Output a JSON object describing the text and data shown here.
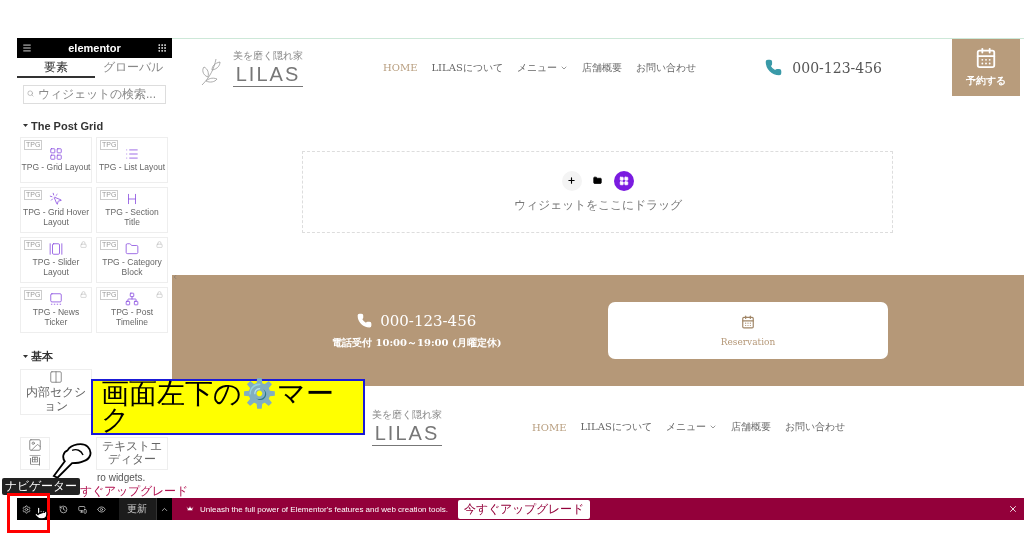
{
  "sidebar": {
    "brand": "elementor",
    "tabs": [
      {
        "label": "要素",
        "selected": true
      },
      {
        "label": "グローバル",
        "selected": false
      }
    ],
    "search": {
      "placeholder": "ウィジェットの検索..."
    },
    "sections": [
      {
        "title": "The Post Grid",
        "expanded": true,
        "widgets": [
          {
            "badge": "TPG",
            "label": "TPG - Grid Layout",
            "locked": false
          },
          {
            "badge": "TPG",
            "label": "TPG - List Layout",
            "locked": false
          },
          {
            "badge": "TPG",
            "label": "TPG - Grid Hover Layout",
            "locked": false
          },
          {
            "badge": "TPG",
            "label": "TPG - Section Title",
            "locked": false
          },
          {
            "badge": "TPG",
            "label": "TPG - Slider Layout",
            "locked": true
          },
          {
            "badge": "TPG",
            "label": "TPG - Category Block",
            "locked": true
          },
          {
            "badge": "TPG",
            "label": "TPG - News Ticker",
            "locked": true
          },
          {
            "badge": "TPG",
            "label": "TPG - Post Timeline",
            "locked": true
          }
        ]
      },
      {
        "title": "基本",
        "expanded": true,
        "widgets": [
          {
            "label": "内部セクション",
            "locked": false
          },
          {
            "label": "画",
            "locked": false
          },
          {
            "label": "テキストエディター",
            "locked": false
          }
        ]
      }
    ],
    "pro_note": "ro widgets.",
    "upgrade_link": "すぐアップグレード",
    "tooltip": "ナビゲーター",
    "update_button": "更新"
  },
  "header": {
    "logo": {
      "tagline": "美を磨く隠れ家",
      "name": "LILAS"
    },
    "nav": [
      {
        "label": "HOME",
        "selected": true,
        "dropdown": false
      },
      {
        "label": "LILASについて",
        "selected": false,
        "dropdown": false
      },
      {
        "label": "メニュー",
        "selected": false,
        "dropdown": true
      },
      {
        "label": "店舗概要",
        "selected": false,
        "dropdown": false
      },
      {
        "label": "お問い合わせ",
        "selected": false,
        "dropdown": false
      }
    ],
    "phone": "000-123-456",
    "reserve": "予約する"
  },
  "drop_zone": {
    "hint": "ウィジェットをここにドラッグ"
  },
  "contact_band": {
    "phone": "000-123-456",
    "hours": "電話受付 10:00～19:00 (月曜定休)",
    "reservation": "Reservation"
  },
  "footer_header": {
    "logo": {
      "tagline": "美を磨く隠れ家",
      "name": "LILAS"
    },
    "nav": [
      {
        "label": "HOME",
        "selected": true,
        "dropdown": false
      },
      {
        "label": "LILASについて",
        "selected": false,
        "dropdown": false
      },
      {
        "label": "メニュー",
        "selected": false,
        "dropdown": true
      },
      {
        "label": "店舗概要",
        "selected": false,
        "dropdown": false
      },
      {
        "label": "お問い合わせ",
        "selected": false,
        "dropdown": false
      }
    ]
  },
  "promo_bar": {
    "message": "Unleash the full power of Elementor's features and web creation tools.",
    "button": "今すぐアップグレード"
  },
  "annotation": {
    "text": "画面左下の⚙️マーク"
  }
}
